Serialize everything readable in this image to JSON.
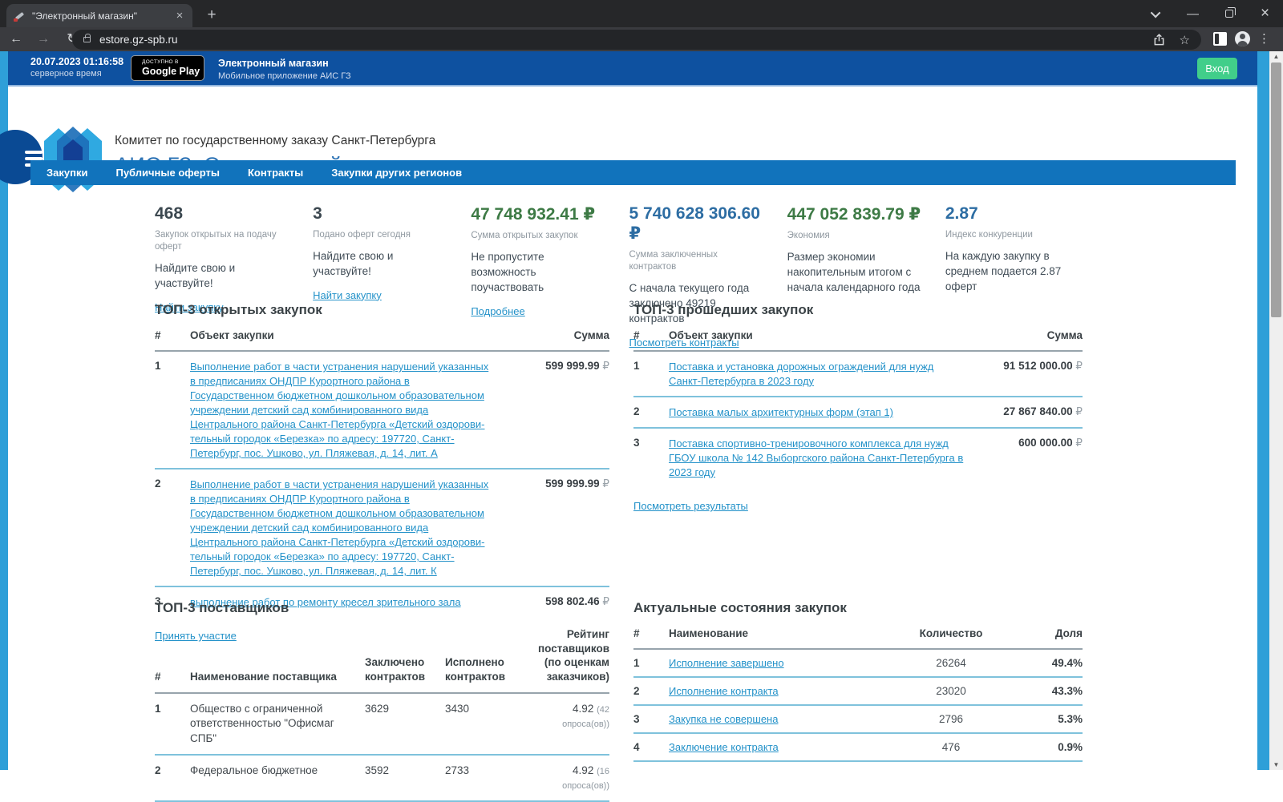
{
  "colors": {
    "topbar_blue": "#0e51a0",
    "nav_blue": "#1173bc",
    "edge_blue": "#2e9fd8",
    "login_green": "#41ce8a",
    "link_blue": "#2492c9",
    "header_title_blue": "#2e74b6",
    "stat_green": "#3d7a45",
    "stat_blue": "#2d6da3",
    "stat_dark": "#3c4850",
    "row_separator": "#7fc2dc"
  },
  "browser": {
    "tab_title": "\"Электронный магазин\"",
    "url": "estore.gz-spb.ru"
  },
  "topbar": {
    "datetime": "20.07.2023 01:16:58",
    "datetime_label": "серверное время",
    "badge_small": "ДОСТУПНО В",
    "badge_store": "Google Play",
    "app_title": "Электронный магазин",
    "app_subtitle": "Мобильное приложение АИС ГЗ",
    "login_label": "Вход"
  },
  "header": {
    "org": "Комитет по государственному заказу Санкт-Петербурга",
    "title": "АИС ГЗ: Электронный магазин"
  },
  "nav": {
    "items": [
      {
        "label": "Закупки"
      },
      {
        "label": "Публичные оферты"
      },
      {
        "label": "Контракты"
      },
      {
        "label": "Закупки других регионов"
      }
    ]
  },
  "stats": [
    {
      "value": "468",
      "label": "Закупок открытых на подачу оферт",
      "desc": "Найдите свою и участвуйте!",
      "link": "Найти закупку"
    },
    {
      "value": "3",
      "label": "Подано оферт сегодня",
      "desc": "Найдите свою и участвуйте!",
      "link": "Найти закупку"
    },
    {
      "value": "47 748 932.41 ₽",
      "label": "Сумма открытых закупок",
      "desc": "Не пропустите возможность поучаствовать",
      "link": "Подробнее"
    },
    {
      "value": "5 740 628 306.60 ₽",
      "label": "Сумма заключенных контрактов",
      "desc": "С начала текущего года заключено 49219 контрактов",
      "link": "Посмотреть контракты"
    },
    {
      "value": "447 052 839.79 ₽",
      "label": "Экономия",
      "desc": "Размер экономии накопительным итогом с начала календарного года"
    },
    {
      "value": "2.87",
      "label": "Индекс конкуренции",
      "desc": "На каждую закупку в среднем подается 2.87 оферт"
    }
  ],
  "open_purchases": {
    "title": "ТОП-3 открытых закупок",
    "col_num": "#",
    "col_object": "Объект закупки",
    "col_sum": "Сумма",
    "rows": [
      {
        "num": "1",
        "text": "Выполнение работ в части устранения нарушений указанных в предписаниях ОНДПР Курортного района в Государственном бюджетном дошкольном образовательном учреждении детский сад комбинированного вида Центрального района Санкт-Петербурга «Детский оздорови-тельный городок «Березка» по адресу: 197720, Санкт-Петербург, пос. Ушково, ул. Пляжевая, д. 14, лит. А",
        "sum": "599 999.99",
        "cur": "₽"
      },
      {
        "num": "2",
        "text": "Выполнение работ в части устранения нарушений указанных в предписаниях ОНДПР Курортного района в Государственном бюджетном дошкольном образовательном учреждении детский сад комбинированного вида Центрального района Санкт-Петербурга «Детский оздорови-тельный городок «Березка» по адресу: 197720, Санкт-Петербург, пос. Ушково, ул. Пляжевая, д. 14, лит. К",
        "sum": "599 999.99",
        "cur": "₽"
      },
      {
        "num": "3",
        "text": "выполнение работ по ремонту кресел зрительного зала",
        "sum": "598 802.46",
        "cur": "₽"
      }
    ],
    "footer_link": "Принять участие"
  },
  "past_purchases": {
    "title": "ТОП-3 прошедших закупок",
    "col_num": "#",
    "col_object": "Объект закупки",
    "col_sum": "Сумма",
    "rows": [
      {
        "num": "1",
        "text": "Поставка и установка дорожных ограждений для нужд Санкт-Петербурга в 2023 году",
        "sum": "91 512 000.00",
        "cur": "₽"
      },
      {
        "num": "2",
        "text": "Поставка малых архитектурных форм (этап 1)",
        "sum": "27 867 840.00",
        "cur": "₽"
      },
      {
        "num": "3",
        "text": "Поставка спортивно-тренировочного комплекса для нужд ГБОУ школа № 142 Выборгского района Санкт-Петербурга в 2023 году",
        "sum": "600 000.00",
        "cur": "₽"
      }
    ],
    "footer_link": "Посмотреть результаты"
  },
  "suppliers": {
    "title": "ТОП-3 поставщиков",
    "cols": [
      "#",
      "Наименование поставщика",
      "Заключено контрактов",
      "Исполнено контрактов",
      "Рейтинг поставщиков (по оценкам заказчиков)"
    ],
    "rows": [
      {
        "num": "1",
        "name": "Общество с ограниченной ответственностью \"Офисмаг СПБ\"",
        "signed": "3629",
        "executed": "3430",
        "rating": "4.92",
        "surveys": "(42 опроса(ов))"
      },
      {
        "num": "2",
        "name": "Федеральное бюджетное",
        "signed": "3592",
        "executed": "2733",
        "rating": "4.92",
        "surveys": "(16 опроса(ов))"
      }
    ]
  },
  "statuses": {
    "title": "Актуальные состояния закупок",
    "cols": [
      "#",
      "Наименование",
      "Количество",
      "Доля"
    ],
    "rows": [
      {
        "num": "1",
        "name": "Исполнение завершено",
        "count": "26264",
        "share": "49.4%"
      },
      {
        "num": "2",
        "name": "Исполнение контракта",
        "count": "23020",
        "share": "43.3%"
      },
      {
        "num": "3",
        "name": "Закупка не совершена",
        "count": "2796",
        "share": "5.3%"
      },
      {
        "num": "4",
        "name": "Заключение контракта",
        "count": "476",
        "share": "0.9%"
      }
    ]
  }
}
